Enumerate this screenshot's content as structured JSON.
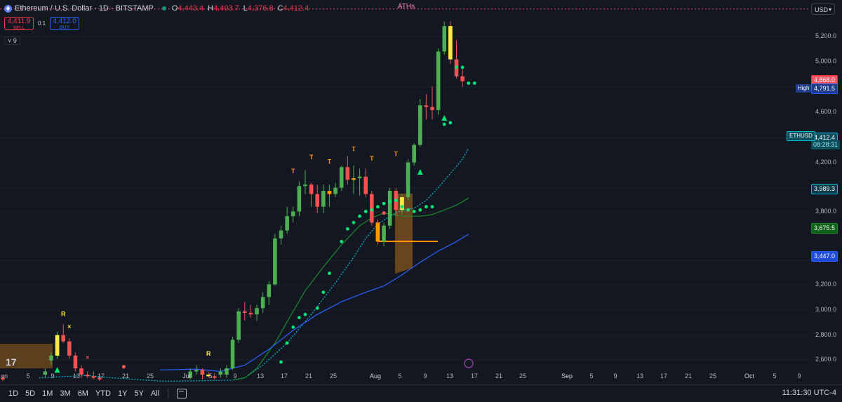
{
  "legend": {
    "title": "Ethereum / U.S. Dollar · 1D · BITSTAMP",
    "open_k": "O",
    "open_v": "4,443.4",
    "high_k": "H",
    "high_v": "4,493.7",
    "low_k": "L",
    "low_v": "4,376.8",
    "close_k": "C",
    "close_v": "4,412.4"
  },
  "trade": {
    "sell_price": "4,411.9",
    "sell_label": "SELL",
    "spread": "0.1",
    "buy_price": "4,412.0",
    "buy_label": "BUY"
  },
  "indicators_count": "9",
  "currency": "USD",
  "labels": {
    "aths": "ATHs",
    "high_label": "High",
    "symbol_tag": "ETHUSD",
    "countdown": "08:28:31",
    "clock": "11:31:30 UTC-4"
  },
  "price_axis": [
    "5,200.0",
    "5,000.0",
    "4,600.0",
    "4,200.0",
    "3,800.0",
    "3,400.0",
    "3,200.0",
    "3,000.0",
    "2,800.0",
    "2,600.0"
  ],
  "price_tags": {
    "ath": "4,868.0",
    "high": "4,791.5",
    "last": "4,412.4",
    "ma_fast": "3,989.3",
    "ma_mid": "3,675.5",
    "ma_slow": "3,447.0"
  },
  "time_axis": [
    "un",
    "5",
    "9",
    "13",
    "17",
    "21",
    "25",
    "Jul",
    "5",
    "9",
    "13",
    "17",
    "21",
    "25",
    "Aug",
    "5",
    "9",
    "13",
    "17",
    "21",
    "25",
    "Sep",
    "5",
    "9",
    "13",
    "17",
    "21",
    "25",
    "Oct",
    "5",
    "9"
  ],
  "timeframes": [
    "1D",
    "5D",
    "1M",
    "3M",
    "6M",
    "YTD",
    "1Y",
    "5Y",
    "All"
  ],
  "colors": {
    "up": "#4caf50",
    "down": "#ef5350",
    "signal_up": "#ffeb3b",
    "signal_down": "#ff9800",
    "dots": "#00e676",
    "ma_fast": "#00bcd4",
    "ma_mid": "#1b8a2a",
    "ma_slow": "#2962ff",
    "ath_line": "#ec407a"
  },
  "markers": {
    "T": "T",
    "R": "R",
    "X": "×"
  },
  "chart_data": {
    "type": "candlestick",
    "title": "Ethereum / U.S. Dollar · 1D · BITSTAMP",
    "ylim": [
      2520,
      5300
    ],
    "ath_level": 4868.0,
    "candles": [
      {
        "d": "2025-06-01",
        "o": 2540,
        "h": 2560,
        "l": 2520,
        "c": 2530
      },
      {
        "d": "2025-06-08",
        "o": 2560,
        "h": 2600,
        "l": 2540,
        "c": 2580
      },
      {
        "d": "2025-06-09",
        "o": 2650,
        "h": 2700,
        "l": 2620,
        "c": 2680
      },
      {
        "d": "2025-06-10",
        "o": 2680,
        "h": 2830,
        "l": 2660,
        "c": 2810
      },
      {
        "d": "2025-06-11",
        "o": 2810,
        "h": 2880,
        "l": 2760,
        "c": 2770
      },
      {
        "d": "2025-06-12",
        "o": 2770,
        "h": 2790,
        "l": 2660,
        "c": 2680
      },
      {
        "d": "2025-06-13",
        "o": 2680,
        "h": 2700,
        "l": 2580,
        "c": 2600
      },
      {
        "d": "2025-06-14",
        "o": 2600,
        "h": 2620,
        "l": 2540,
        "c": 2560
      },
      {
        "d": "2025-06-15",
        "o": 2560,
        "h": 2580,
        "l": 2540,
        "c": 2550
      },
      {
        "d": "2025-06-16",
        "o": 2550,
        "h": 2580,
        "l": 2530,
        "c": 2540
      },
      {
        "d": "2025-06-17",
        "o": 2540,
        "h": 2560,
        "l": 2520,
        "c": 2530
      },
      {
        "d": "2025-07-02",
        "o": 2540,
        "h": 2600,
        "l": 2530,
        "c": 2580
      },
      {
        "d": "2025-07-03",
        "o": 2580,
        "h": 2620,
        "l": 2560,
        "c": 2590
      },
      {
        "d": "2025-07-04",
        "o": 2590,
        "h": 2600,
        "l": 2530,
        "c": 2560
      },
      {
        "d": "2025-07-05",
        "o": 2560,
        "h": 2580,
        "l": 2540,
        "c": 2550
      },
      {
        "d": "2025-07-06",
        "o": 2550,
        "h": 2570,
        "l": 2530,
        "c": 2540
      },
      {
        "d": "2025-07-07",
        "o": 2560,
        "h": 2600,
        "l": 2540,
        "c": 2580
      },
      {
        "d": "2025-07-08",
        "o": 2560,
        "h": 2620,
        "l": 2540,
        "c": 2600
      },
      {
        "d": "2025-07-09",
        "o": 2600,
        "h": 2800,
        "l": 2590,
        "c": 2780
      },
      {
        "d": "2025-07-10",
        "o": 2780,
        "h": 2980,
        "l": 2760,
        "c": 2960
      },
      {
        "d": "2025-07-11",
        "o": 2960,
        "h": 3020,
        "l": 2900,
        "c": 2950
      },
      {
        "d": "2025-07-12",
        "o": 2950,
        "h": 3000,
        "l": 2920,
        "c": 2940
      },
      {
        "d": "2025-07-13",
        "o": 2940,
        "h": 3000,
        "l": 2900,
        "c": 2980
      },
      {
        "d": "2025-07-14",
        "o": 2980,
        "h": 3080,
        "l": 2950,
        "c": 3050
      },
      {
        "d": "2025-07-15",
        "o": 3050,
        "h": 3150,
        "l": 3000,
        "c": 3130
      },
      {
        "d": "2025-07-16",
        "o": 3130,
        "h": 3450,
        "l": 3120,
        "c": 3420
      },
      {
        "d": "2025-07-17",
        "o": 3420,
        "h": 3500,
        "l": 3380,
        "c": 3470
      },
      {
        "d": "2025-07-18",
        "o": 3470,
        "h": 3620,
        "l": 3450,
        "c": 3560
      },
      {
        "d": "2025-07-19",
        "o": 3560,
        "h": 3620,
        "l": 3520,
        "c": 3590
      },
      {
        "d": "2025-07-20",
        "o": 3590,
        "h": 3780,
        "l": 3560,
        "c": 3750
      },
      {
        "d": "2025-07-21",
        "o": 3750,
        "h": 3850,
        "l": 3700,
        "c": 3760
      },
      {
        "d": "2025-07-22",
        "o": 3760,
        "h": 3770,
        "l": 3620,
        "c": 3700
      },
      {
        "d": "2025-07-23",
        "o": 3700,
        "h": 3760,
        "l": 3580,
        "c": 3620
      },
      {
        "d": "2025-07-24",
        "o": 3620,
        "h": 3760,
        "l": 3580,
        "c": 3720
      },
      {
        "d": "2025-07-25",
        "o": 3720,
        "h": 3760,
        "l": 3620,
        "c": 3700
      },
      {
        "d": "2025-07-26",
        "o": 3700,
        "h": 3770,
        "l": 3680,
        "c": 3740
      },
      {
        "d": "2025-07-27",
        "o": 3740,
        "h": 3880,
        "l": 3720,
        "c": 3870
      },
      {
        "d": "2025-07-28",
        "o": 3870,
        "h": 3940,
        "l": 3760,
        "c": 3790
      },
      {
        "d": "2025-07-29",
        "o": 3790,
        "h": 3880,
        "l": 3700,
        "c": 3800
      },
      {
        "d": "2025-07-30",
        "o": 3800,
        "h": 3860,
        "l": 3690,
        "c": 3810
      },
      {
        "d": "2025-07-31",
        "o": 3810,
        "h": 3860,
        "l": 3680,
        "c": 3700
      },
      {
        "d": "2025-08-01",
        "o": 3700,
        "h": 3720,
        "l": 3500,
        "c": 3520
      },
      {
        "d": "2025-08-02",
        "o": 3520,
        "h": 3540,
        "l": 3380,
        "c": 3400
      },
      {
        "d": "2025-08-03",
        "o": 3400,
        "h": 3520,
        "l": 3370,
        "c": 3500
      },
      {
        "d": "2025-08-04",
        "o": 3500,
        "h": 3740,
        "l": 3480,
        "c": 3720
      },
      {
        "d": "2025-08-05",
        "o": 3720,
        "h": 3740,
        "l": 3560,
        "c": 3600
      },
      {
        "d": "2025-08-06",
        "o": 3600,
        "h": 3700,
        "l": 3570,
        "c": 3680
      },
      {
        "d": "2025-08-07",
        "o": 3680,
        "h": 3920,
        "l": 3660,
        "c": 3900
      },
      {
        "d": "2025-08-08",
        "o": 3900,
        "h": 4020,
        "l": 3880,
        "c": 4010
      },
      {
        "d": "2025-08-09",
        "o": 4010,
        "h": 4300,
        "l": 4000,
        "c": 4260
      },
      {
        "d": "2025-08-10",
        "o": 4260,
        "h": 4330,
        "l": 4170,
        "c": 4250
      },
      {
        "d": "2025-08-11",
        "o": 4250,
        "h": 4380,
        "l": 4170,
        "c": 4230
      },
      {
        "d": "2025-08-12",
        "o": 4230,
        "h": 4620,
        "l": 4200,
        "c": 4600
      },
      {
        "d": "2025-08-13",
        "o": 4600,
        "h": 4790,
        "l": 4580,
        "c": 4760
      },
      {
        "d": "2025-08-14",
        "o": 4760,
        "h": 4790,
        "l": 4520,
        "c": 4550
      },
      {
        "d": "2025-08-15",
        "o": 4550,
        "h": 4670,
        "l": 4430,
        "c": 4443
      },
      {
        "d": "2025-08-16",
        "o": 4443,
        "h": 4494,
        "l": 4377,
        "c": 4412
      }
    ]
  }
}
